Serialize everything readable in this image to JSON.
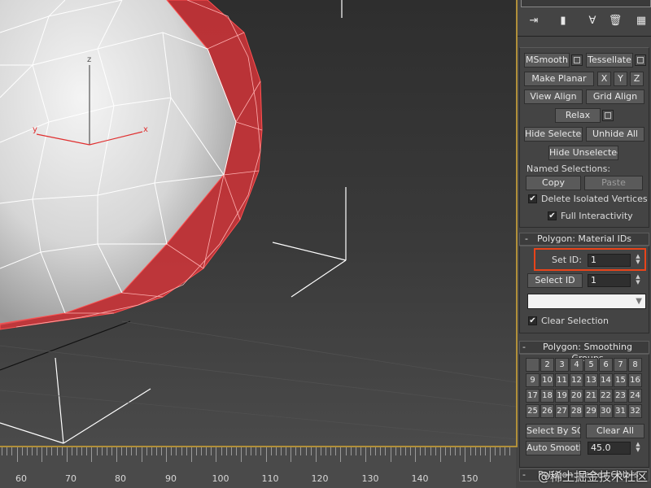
{
  "ruler": {
    "labels": [
      "60",
      "70",
      "80",
      "90",
      "100",
      "110",
      "120",
      "130",
      "140",
      "150"
    ]
  },
  "viewport": {
    "gizmo_labels": {
      "z": "z",
      "y": "y",
      "x": "x"
    },
    "colors": {
      "selection": "#e8343a",
      "wire": "#ffffff",
      "axis": "#e03030"
    }
  },
  "toolbar": {
    "icons": [
      "pin-icon",
      "modifier-stack-icon",
      "fork-icon",
      "trash-icon",
      "configure-icon"
    ]
  },
  "edit_geometry": {
    "msmooth": "MSmooth",
    "tessellate": "Tessellate",
    "make_planar": "Make Planar",
    "x": "X",
    "y": "Y",
    "z": "Z",
    "view_align": "View Align",
    "grid_align": "Grid Align",
    "relax": "Relax",
    "hide_selected": "Hide Selected",
    "unhide_all": "Unhide All",
    "hide_unselected": "Hide Unselected",
    "named_selections": "Named Selections:",
    "copy": "Copy",
    "paste": "Paste",
    "delete_isolated": "Delete Isolated Vertices",
    "full_interactivity": "Full Interactivity"
  },
  "material_ids": {
    "minus": "-",
    "title": "Polygon: Material IDs",
    "set_id_label": "Set ID:",
    "set_id_value": "1",
    "select_id_button": "Select ID",
    "select_id_value": "1",
    "clear_selection": "Clear Selection"
  },
  "smoothing_groups": {
    "minus": "-",
    "title": "Polygon: Smoothing Groups",
    "cells": [
      "",
      "2",
      "3",
      "4",
      "5",
      "6",
      "7",
      "8",
      "9",
      "10",
      "11",
      "12",
      "13",
      "14",
      "15",
      "16",
      "17",
      "18",
      "19",
      "20",
      "21",
      "22",
      "23",
      "24",
      "25",
      "26",
      "27",
      "28",
      "29",
      "30",
      "31",
      "32"
    ],
    "select_by_sg": "Select By SG",
    "clear_all": "Clear All",
    "auto_smooth": "Auto Smooth",
    "auto_smooth_value": "45.0"
  },
  "vertex_colors": {
    "minus": "-",
    "title": "Polygon: Vertex Colors"
  },
  "watermark": "@稀土掘金技术社区",
  "check_mark": "✔"
}
